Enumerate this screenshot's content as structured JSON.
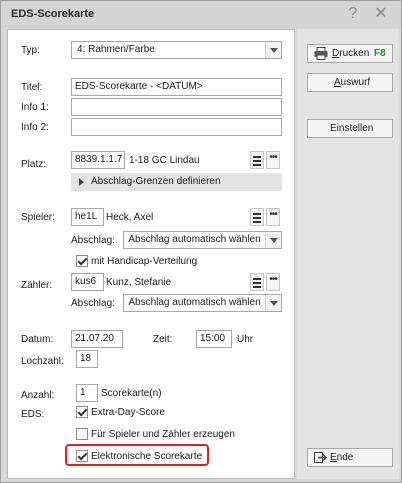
{
  "window": {
    "title": "EDS-Scorekarte",
    "help_icon": "?",
    "close_icon": "✕"
  },
  "form": {
    "typ": {
      "label": "Typ:",
      "value": "4: Rahmen/Farbe"
    },
    "titel": {
      "label": "Titel:",
      "value": "EDS-Scorekarte - <DATUM>"
    },
    "info1": {
      "label": "Info 1:",
      "value": ""
    },
    "info2": {
      "label": "Info 2:",
      "value": ""
    },
    "platz": {
      "label": "Platz:",
      "code": "8839.1.1.7",
      "name": "1-18 GC Lindau",
      "abschlag_grenzen": "Abschlag-Grenzen definieren"
    },
    "spieler": {
      "label": "Spieler:",
      "code": "he1L",
      "name": "Heck, Axel",
      "abschlag_label": "Abschlag:",
      "abschlag_value": "Abschlag automatisch wählen",
      "handicap_label": "mit Handicap-Verteilung",
      "handicap_checked": true
    },
    "zaehler": {
      "label": "Zähler:",
      "code": "kus6",
      "name": "Kunz, Stefanie",
      "abschlag_label": "Abschlag:",
      "abschlag_value": "Abschlag automatisch wählen"
    },
    "datum": {
      "label": "Datum:",
      "value": "21.07.20"
    },
    "zeit": {
      "label": "Zeit:",
      "value": "15:00",
      "unit": "Uhr"
    },
    "lochzahl": {
      "label": "Lochzahl:",
      "value": "18"
    },
    "anzahl": {
      "label": "Anzahl:",
      "value": "1",
      "unit": "Scorekarte(n)"
    },
    "eds": {
      "label": "EDS:",
      "extra_day": {
        "label": "Extra-Day-Score",
        "checked": true
      },
      "fuer_beide": {
        "label": "Für Spieler und Zähler erzeugen",
        "checked": false
      },
      "elektronisch": {
        "label": "Elektronische Scorekarte",
        "checked": true
      }
    }
  },
  "menu_icons": {
    "list": "≡",
    "more": "•••"
  },
  "buttons": {
    "drucken": {
      "first": "D",
      "rest": "rucken",
      "shortcut": "F8"
    },
    "auswurf": {
      "first": "A",
      "rest": "uswurf"
    },
    "einstellen": {
      "label": "Einstellen"
    },
    "ende": {
      "first": "E",
      "rest": "nde"
    }
  },
  "colors": {
    "highlight": "#e02020",
    "shortcut": "#2e8b2e",
    "background": "#d9d9d9"
  }
}
